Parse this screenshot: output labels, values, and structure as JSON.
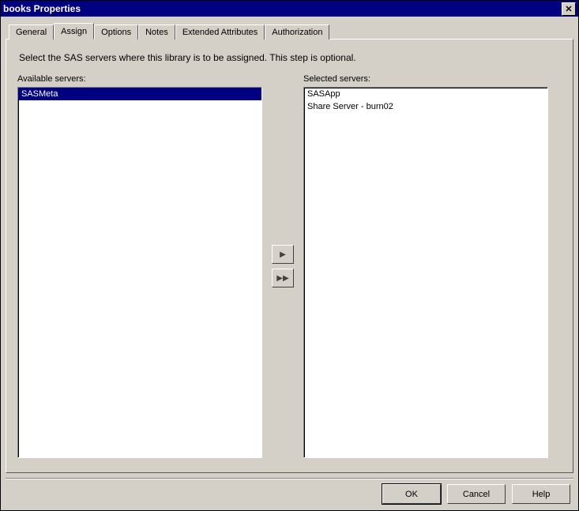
{
  "title": "books Properties",
  "tabs": [
    "General",
    "Assign",
    "Options",
    "Notes",
    "Extended Attributes",
    "Authorization"
  ],
  "active_tab": 1,
  "instruction": "Select the SAS servers where this library is to be assigned. This step is optional.",
  "available_label": "Available servers:",
  "selected_label": "Selected servers:",
  "available_servers": [
    "SASMeta"
  ],
  "available_selected_index": 0,
  "selected_servers": [
    "SASApp",
    "Share Server - burn02"
  ],
  "move_right_glyph": "▶",
  "move_all_right_glyph": "▶▶",
  "buttons": {
    "ok": "OK",
    "cancel": "Cancel",
    "help": "Help"
  },
  "close_glyph": "✕"
}
